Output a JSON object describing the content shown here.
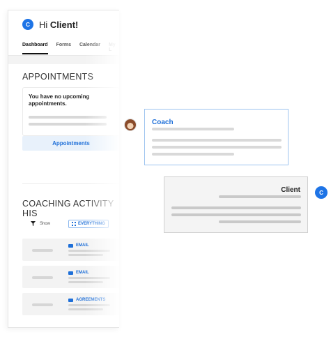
{
  "header": {
    "avatar_initial": "C",
    "greeting_prefix": "Hi",
    "greeting_name": "Client!"
  },
  "tabs": [
    {
      "label": "Dashboard",
      "active": true
    },
    {
      "label": "Forms",
      "active": false
    },
    {
      "label": "Calendar",
      "active": false
    },
    {
      "label": "My L",
      "active": false
    }
  ],
  "appointments": {
    "title": "APPOINTMENTS",
    "empty_message": "You have no upcoming appointments.",
    "button_label": "Appointments"
  },
  "activity": {
    "title": "COACHING ACTIVITY HIS",
    "filter_label": "Show",
    "filter_value": "EVERYTHING",
    "items": [
      {
        "type": "EMAIL",
        "icon": "envelope-icon"
      },
      {
        "type": "EMAIL",
        "icon": "envelope-icon"
      },
      {
        "type": "AGREEMENTS",
        "icon": "document-icon"
      }
    ]
  },
  "messages": {
    "coach": {
      "name": "Coach"
    },
    "client": {
      "name": "Client",
      "avatar_initial": "C"
    }
  },
  "colors": {
    "accent": "#1e6fd8",
    "coach_border": "#9cc3ef",
    "client_bg": "#f4f4f4"
  }
}
